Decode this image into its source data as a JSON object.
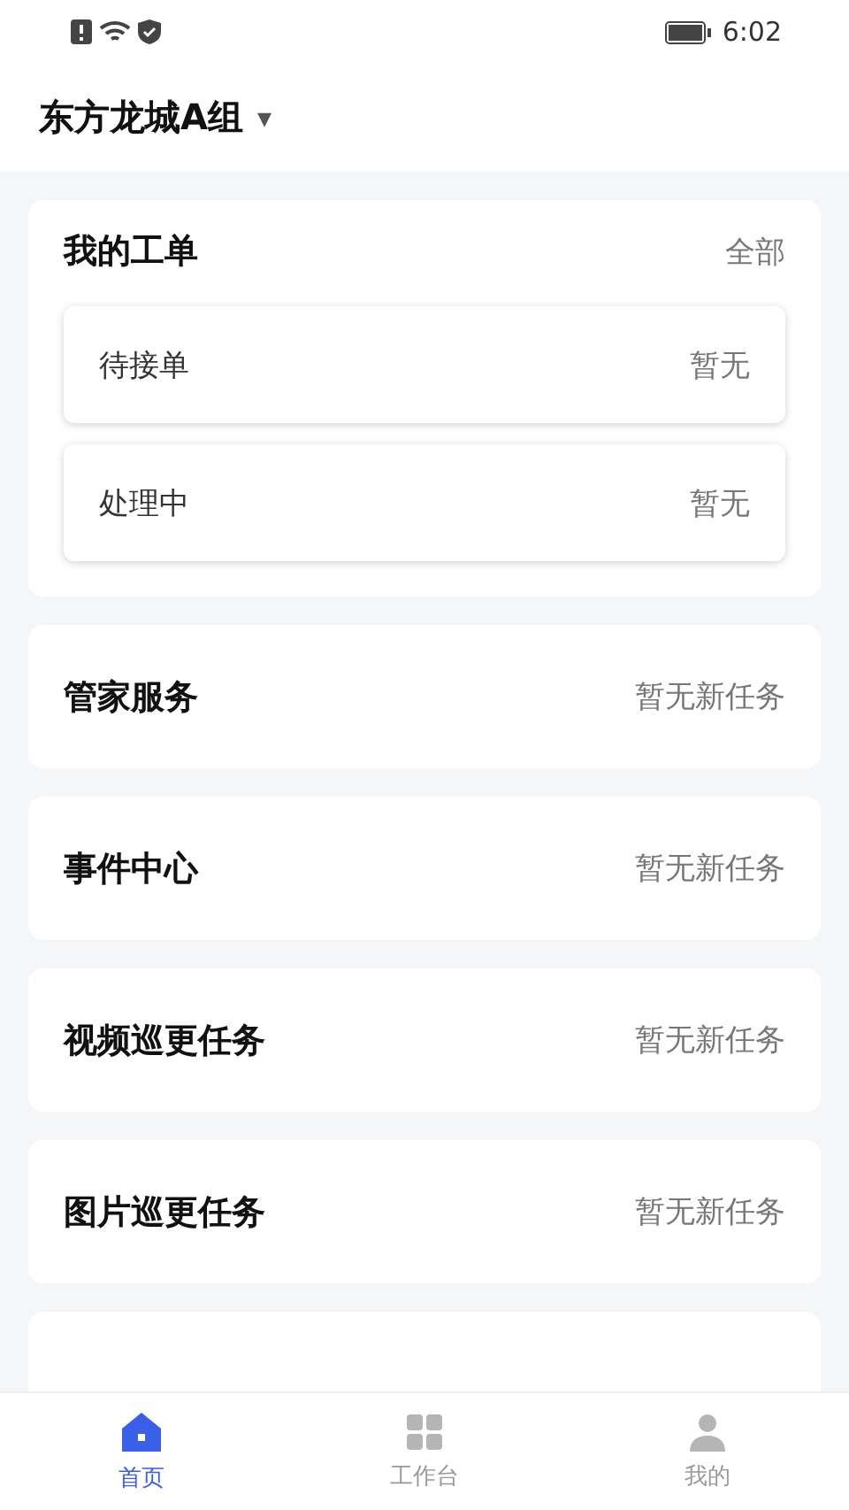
{
  "status_bar": {
    "time": "6:02"
  },
  "header": {
    "title": "东方龙城A组",
    "dropdown": "▾"
  },
  "my_orders": {
    "title": "我的工单",
    "link": "全部",
    "items": [
      {
        "label": "待接单",
        "value": "暂无"
      },
      {
        "label": "处理中",
        "value": "暂无"
      }
    ]
  },
  "sections": [
    {
      "title": "管家服务",
      "status": "暂无新任务"
    },
    {
      "title": "事件中心",
      "status": "暂无新任务"
    },
    {
      "title": "视频巡更任务",
      "status": "暂无新任务"
    },
    {
      "title": "图片巡更任务",
      "status": "暂无新任务"
    }
  ],
  "bottom_nav": [
    {
      "label": "首页",
      "kind": "home",
      "selected": true
    },
    {
      "label": "工作台",
      "kind": "work",
      "selected": false
    },
    {
      "label": "我的",
      "kind": "me",
      "selected": false
    }
  ]
}
